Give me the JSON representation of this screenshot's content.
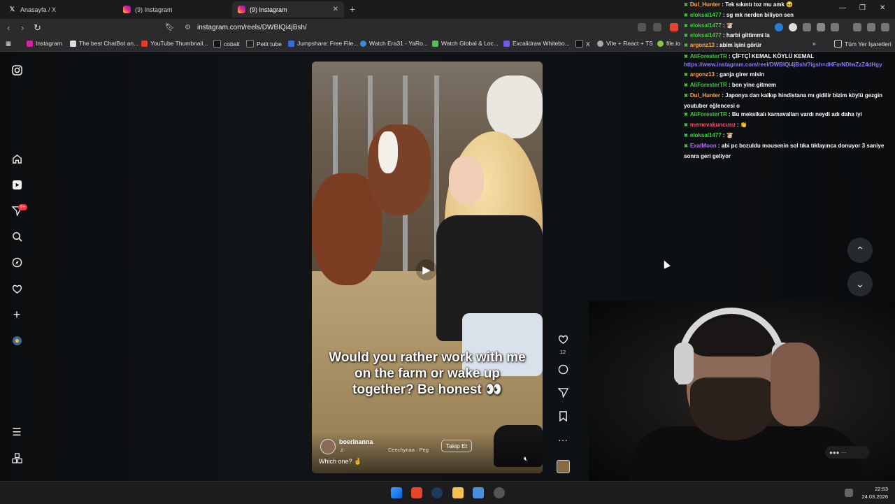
{
  "browser": {
    "tabs": [
      {
        "label": "Anasayfa / X",
        "icon": "x-logo-icon"
      },
      {
        "label": "(9) Instagram",
        "icon": "instagram-icon"
      },
      {
        "label": "(9) Instagram",
        "icon": "instagram-icon",
        "active": true
      }
    ],
    "url": "instagram.com/reels/DWBIQi4jBsh/",
    "bookmarks": [
      "Instagram",
      "The best ChatBot an...",
      "YouTube Thumbnail...",
      "cobalt",
      "Petit tube",
      "Jumpshare: Free File...",
      "Watch Era31 - YaRo...",
      "Watch Global & Loc...",
      "Excalidraw Whitebo...",
      "X",
      "Vite + React + TS",
      "file.io"
    ],
    "all_bookmarks": "Tüm Yer İşaretleri",
    "overflow": "»"
  },
  "sidebar": {
    "notification_badge": "9+"
  },
  "reel": {
    "caption": "Would you rather work with me on the farm or wake up together? Be honest 👀",
    "username": "boerinanna",
    "audio": "Ceechynaa · Peg",
    "follow_label": "Takip Et",
    "description": "Which one? 🤞",
    "like_count": "12"
  },
  "chat": {
    "messages": [
      {
        "user": "Dul_Hunter",
        "color": "#ffa94d",
        "text": ": Tek sıkıntı toz mu amk 😖"
      },
      {
        "user": "eloksal1477",
        "color": "#3ecf3e",
        "text": ": sg mk nerden biliyon sen"
      },
      {
        "user": "eloksal1477",
        "color": "#3ecf3e",
        "text": ": 🐮"
      },
      {
        "user": "eloksal1477",
        "color": "#3ecf3e",
        "text": ": harbi gittimmi la"
      },
      {
        "user": "argonz13",
        "color": "#ffa94d",
        "text": ": abim işini görür"
      },
      {
        "user": "AliForesterTR",
        "color": "#3ecf3e",
        "text": ": ÇİFTÇİ KEMAL KÖYLÜ KEMAL"
      },
      {
        "user": "",
        "color": "#8a7cff",
        "text": "https://www.instagram.com/reel/DWBIQi4jBsh/?igsh=dHFmNDIwZzZ4dHgy"
      },
      {
        "user": "argonz13",
        "color": "#ffa94d",
        "text": ": ganja girer misin"
      },
      {
        "user": "AliForesterTR",
        "color": "#3ecf3e",
        "text": ": ben yine gitmem"
      },
      {
        "user": "Dul_Hunter",
        "color": "#ffa94d",
        "text": ": Japonya dan kalkıp hindistana mı gidilir bizim köylü gezgin youtuber eğlencesi o"
      },
      {
        "user": "AliForesterTR",
        "color": "#3ecf3e",
        "text": ": Bu meksikalı karnavalları vardı neydi adı daha iyi"
      },
      {
        "user": "memevakuncusu",
        "color": "#ff4d6d",
        "text": ": 👏"
      },
      {
        "user": "eloksal1477",
        "color": "#3ecf3e",
        "text": ": 🐮"
      },
      {
        "user": "ExalMoon",
        "color": "#b36bff",
        "text": ": abi pc bozuldu mousenin sol tıka tıklayınca donuyor 3 saniye sonra geri geliyor"
      }
    ]
  },
  "taskbar": {
    "time": "22:53",
    "date": "24.03.2026"
  }
}
